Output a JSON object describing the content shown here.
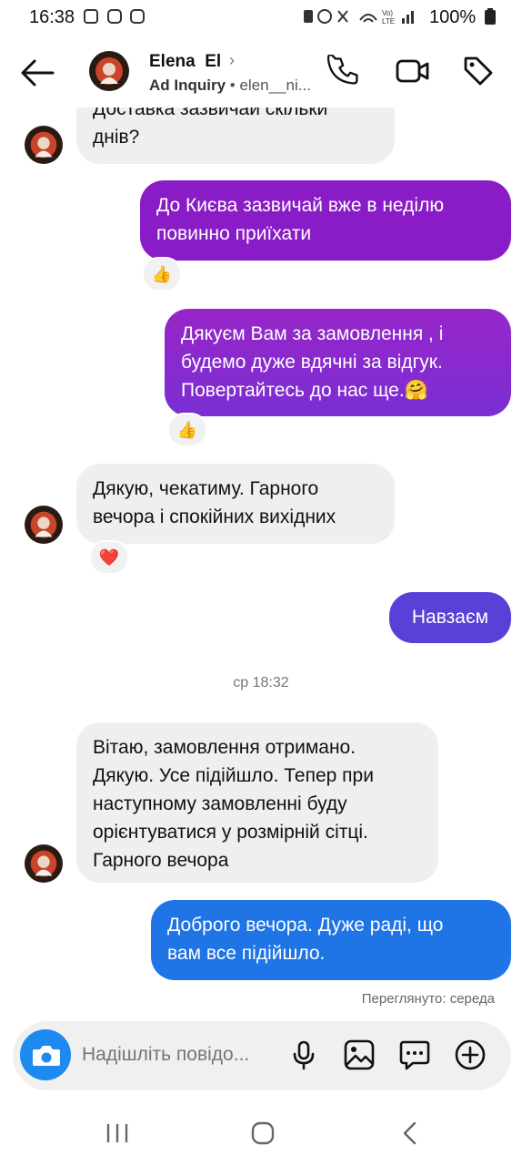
{
  "status_bar": {
    "time": "16:38",
    "battery": "100%"
  },
  "header": {
    "name": "Elena  El",
    "subtitle_bold": "Ad Inquiry",
    "subtitle_rest": " • elen__ni..."
  },
  "messages": [
    {
      "from": "them",
      "text": "Доставка зазвичай скільки днів?"
    },
    {
      "from": "me",
      "text": "До Києва зазвичай вже в неділю повинно приїхати",
      "reaction": "👍"
    },
    {
      "from": "me",
      "text": "Дякуєм Вам  за замовлення , і будемо дуже вдячні за відгук. Повертайтесь до нас ще.🤗",
      "reaction": "👍"
    },
    {
      "from": "them",
      "text": "Дякую, чекатиму. Гарного вечора і спокійних вихідних",
      "reaction": "❤️"
    },
    {
      "from": "me",
      "text": "Навзаєм"
    },
    {
      "from": "them",
      "text": "Вітаю, замовлення отримано. Дякую. Усе підійшло. Тепер при наступному замовленні буду орієнтуватися у розмірній сітці. Гарного вечора"
    },
    {
      "from": "me",
      "text": "Доброго вечора.  Дуже раді, що вам все підійшло."
    }
  ],
  "bubble_lines": {
    "m0": [
      "Доставка зазвичай скільки",
      "днів?"
    ],
    "m1": [
      "До Києва зазвичай вже в неділю",
      "повинно приїхати"
    ],
    "m2": [
      "Дякуєм Вам  за замовлення , і",
      "будемо дуже вдячні за відгук.",
      "Повертайтесь до нас ще.🤗"
    ],
    "m3": [
      "Дякую, чекатиму. Гарного",
      "вечора і спокійних вихідних"
    ],
    "m4": [
      "Навзаєм"
    ],
    "m5": [
      "Вітаю, замовлення отримано.",
      "Дякую. Усе підійшло. Тепер при",
      "наступному замовленні буду",
      "орієнтуватися у розмірній сітці.",
      "Гарного вечора"
    ],
    "m6": [
      "Доброго вечора.  Дуже раді, що",
      "вам все підійшло."
    ]
  },
  "timestamp": "ср 18:32",
  "seen": "Переглянуто: середа",
  "composer": {
    "placeholder": "Надішліть повідо..."
  },
  "icons": [
    "back-arrow-icon",
    "phone-icon",
    "video-camera-icon",
    "tag-icon",
    "camera-icon",
    "microphone-icon",
    "gallery-icon",
    "sticker-chat-icon",
    "plus-circle-icon",
    "recents-icon",
    "home-icon",
    "nav-back-icon"
  ],
  "colors": {
    "purple": "#8a1cc7",
    "violet": "#5a3fd8",
    "blue": "#1f74e6",
    "incoming": "#efeff0",
    "camera_button": "#1d8af0"
  }
}
